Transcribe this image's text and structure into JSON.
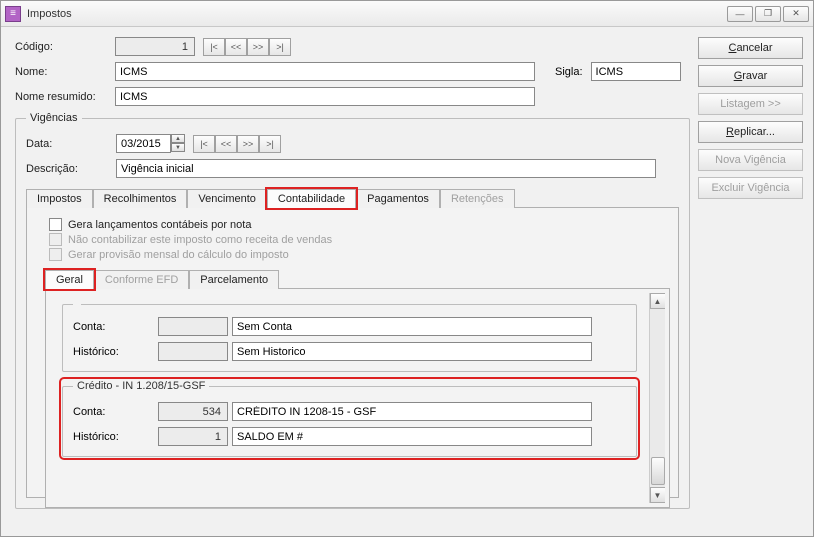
{
  "window": {
    "title": "Impostos"
  },
  "header": {
    "labels": {
      "codigo": "Código:",
      "nome": "Nome:",
      "nome_resumido": "Nome resumido:",
      "sigla": "Sigla:"
    },
    "codigo_value": "1",
    "nome_value": "ICMS",
    "nome_resumido_value": "ICMS",
    "sigla_value": "ICMS",
    "nav": {
      "first": "|<",
      "prev": "<<",
      "next": ">>",
      "last": ">|"
    }
  },
  "vigencias": {
    "legend": "Vigências",
    "labels": {
      "data": "Data:",
      "descricao": "Descrição:"
    },
    "data_value": "03/2015",
    "descricao_value": "Vigência inicial",
    "nav": {
      "first": "|<",
      "prev": "<<",
      "next": ">>",
      "last": ">|"
    },
    "tabs": {
      "impostos": "Impostos",
      "recolhimentos": "Recolhimentos",
      "vencimento": "Vencimento",
      "contabilidade": "Contabilidade",
      "pagamentos": "Pagamentos",
      "retencoes": "Retenções"
    },
    "checks": {
      "c1": "Gera lançamentos contábeis por nota",
      "c2": "Não contabilizar este imposto como receita de vendas",
      "c3": "Gerar provisão mensal do cálculo do imposto"
    },
    "subtabs": {
      "geral": "Geral",
      "conforme_efd": "Conforme EFD",
      "parcelamento": "Parcelamento"
    },
    "grupo1": {
      "labels": {
        "conta": "Conta:",
        "historico": "Histórico:"
      },
      "conta_code": "",
      "conta_descr": "Sem Conta",
      "hist_code": "",
      "hist_descr": "Sem Historico"
    },
    "grupo_credito": {
      "legend": "Crédito - IN 1.208/15-GSF",
      "labels": {
        "conta": "Conta:",
        "historico": "Histórico:"
      },
      "conta_code": "534",
      "conta_descr": "CRÉDITO IN 1208-15 - GSF",
      "hist_code": "1",
      "hist_descr": "SALDO EM #"
    }
  },
  "buttons": {
    "cancelar": "Cancelar",
    "gravar": "Gravar",
    "listagem": "Listagem >>",
    "replicar": "Replicar...",
    "nova_vig": "Nova Vigência",
    "excluir_vig": "Excluir Vigência"
  },
  "win_controls": {
    "min": "—",
    "max": "❐",
    "close": "✕"
  }
}
